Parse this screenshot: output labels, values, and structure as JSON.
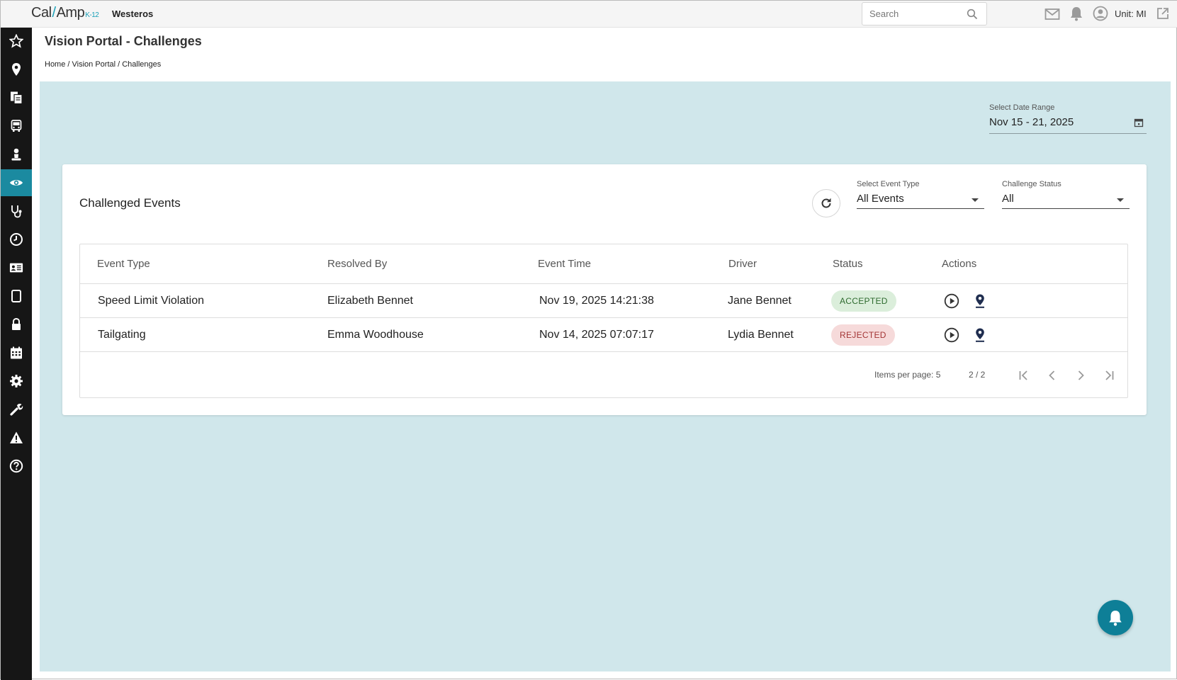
{
  "header": {
    "logo_main": "Cal",
    "logo_slash": "/",
    "logo_amp": "Amp",
    "logo_sub": "K-12",
    "org_name": "Westeros",
    "search_placeholder": "Search",
    "unit_label": "Unit: MI"
  },
  "sidebar": {
    "items": [
      {
        "icon": "star-icon",
        "active": false
      },
      {
        "icon": "map-pin-icon",
        "active": false
      },
      {
        "icon": "documents-icon",
        "active": false
      },
      {
        "icon": "bus-icon",
        "active": false
      },
      {
        "icon": "person-icon",
        "active": false
      },
      {
        "icon": "eye-icon",
        "active": true
      },
      {
        "icon": "stethoscope-icon",
        "active": false
      },
      {
        "icon": "clock-icon",
        "active": false
      },
      {
        "icon": "id-card-icon",
        "active": false
      },
      {
        "icon": "tablet-icon",
        "active": false
      },
      {
        "icon": "lock-icon",
        "active": false
      },
      {
        "icon": "calendar-icon",
        "active": false
      },
      {
        "icon": "gear-icon",
        "active": false
      },
      {
        "icon": "wrench-icon",
        "active": false
      },
      {
        "icon": "warning-icon",
        "active": false
      },
      {
        "icon": "help-icon",
        "active": false
      }
    ]
  },
  "page": {
    "title": "Vision Portal - Challenges",
    "breadcrumb": "Home / Vision Portal / Challenges"
  },
  "filters": {
    "date_range_label": "Select Date Range",
    "date_range_value": "Nov 15 - 21, 2025",
    "event_type_label": "Select Event Type",
    "event_type_value": "All Events",
    "status_label": "Challenge Status",
    "status_value": "All"
  },
  "card": {
    "title": "Challenged Events"
  },
  "table": {
    "columns": [
      "Event Type",
      "Resolved By",
      "Event Time",
      "Driver",
      "Status",
      "Actions"
    ],
    "rows": [
      {
        "event_type": "Speed Limit Violation",
        "resolved_by": "Elizabeth Bennet",
        "event_time": "Nov 19, 2025 14:21:38",
        "driver": "Jane Bennet",
        "status": "ACCEPTED"
      },
      {
        "event_type": "Tailgating",
        "resolved_by": "Emma Woodhouse",
        "event_time": "Nov 14, 2025 07:07:17",
        "driver": "Lydia Bennet",
        "status": "REJECTED"
      }
    ]
  },
  "pagination": {
    "items_per_page": "Items per page: 5",
    "page_info": "2 / 2"
  },
  "colors": {
    "accent": "#1b8aa0",
    "content_bg": "#d0e7eb",
    "sidebar_bg": "#161616",
    "fab": "#0e7f97",
    "accepted_bg": "#dbeedb",
    "rejected_bg": "#f6dada"
  }
}
